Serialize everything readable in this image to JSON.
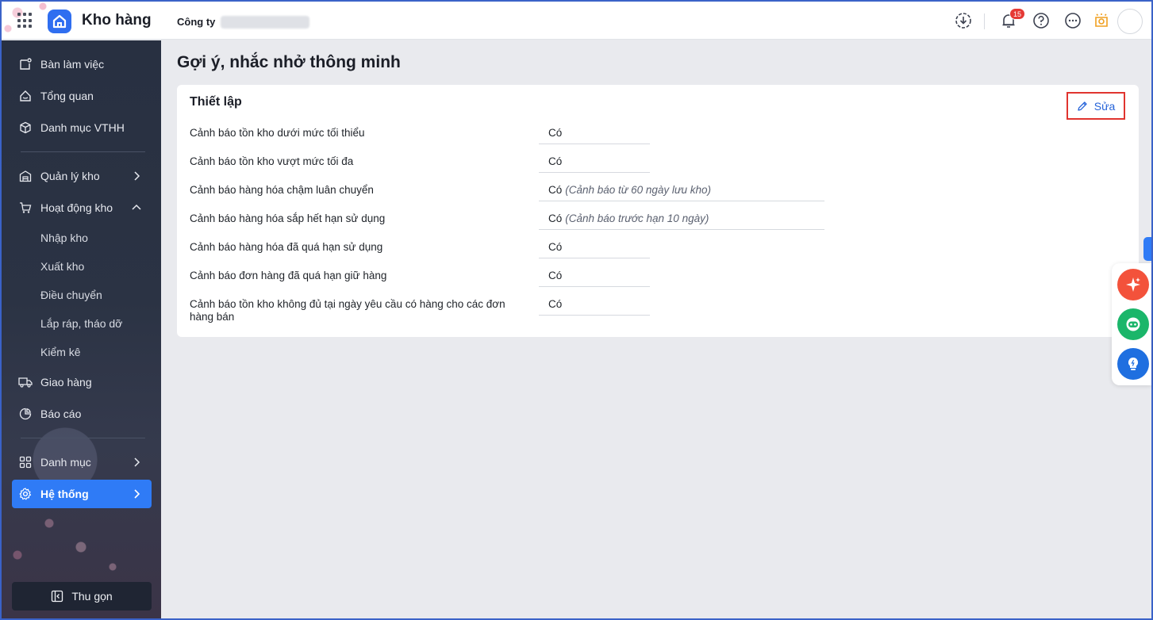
{
  "header": {
    "app_title": "Kho hàng",
    "company_label": "Công ty",
    "notification_count": "15"
  },
  "sidebar": {
    "items": [
      {
        "label": "Bàn làm việc",
        "icon": "desk-icon"
      },
      {
        "label": "Tổng quan",
        "icon": "overview-icon"
      },
      {
        "label": "Danh mục VTHH",
        "icon": "box-icon"
      },
      {
        "label": "Quản lý kho",
        "icon": "warehouse-icon"
      },
      {
        "label": "Hoạt động kho",
        "icon": "cart-icon"
      },
      {
        "label": "Giao hàng",
        "icon": "truck-icon"
      },
      {
        "label": "Báo cáo",
        "icon": "pie-chart-icon"
      },
      {
        "label": "Danh mục",
        "icon": "grid-icon"
      },
      {
        "label": "Hệ thống",
        "icon": "gear-icon"
      }
    ],
    "subitems": [
      "Nhập kho",
      "Xuất kho",
      "Điều chuyển",
      "Lắp ráp, tháo dỡ",
      "Kiểm kê"
    ],
    "collapse_label": "Thu gọn"
  },
  "main": {
    "page_title": "Gợi ý, nhắc nhở thông minh",
    "card_title": "Thiết lập",
    "edit_label": "Sửa",
    "settings": [
      {
        "label": "Cảnh báo tồn kho dưới mức tối thiểu",
        "value": "Có",
        "note": ""
      },
      {
        "label": "Cảnh báo tồn kho vượt mức tối đa",
        "value": "Có",
        "note": ""
      },
      {
        "label": "Cảnh báo hàng hóa chậm luân chuyển",
        "value": "Có",
        "note": "(Cảnh báo từ 60 ngày lưu kho)"
      },
      {
        "label": "Cảnh báo hàng hóa sắp hết hạn sử dụng",
        "value": "Có",
        "note": "(Cảnh báo trước hạn 10 ngày)"
      },
      {
        "label": "Cảnh báo hàng hóa đã quá hạn sử dụng",
        "value": "Có",
        "note": ""
      },
      {
        "label": "Cảnh báo đơn hàng đã quá hạn giữ hàng",
        "value": "Có",
        "note": ""
      },
      {
        "label": "Cảnh báo tồn kho không đủ tại ngày yêu cầu có hàng cho các đơn hàng bán",
        "value": "Có",
        "note": ""
      }
    ]
  },
  "colors": {
    "accent": "#2f7bf6",
    "highlight_border": "#e0342f",
    "sidebar_bg": "#283041"
  }
}
